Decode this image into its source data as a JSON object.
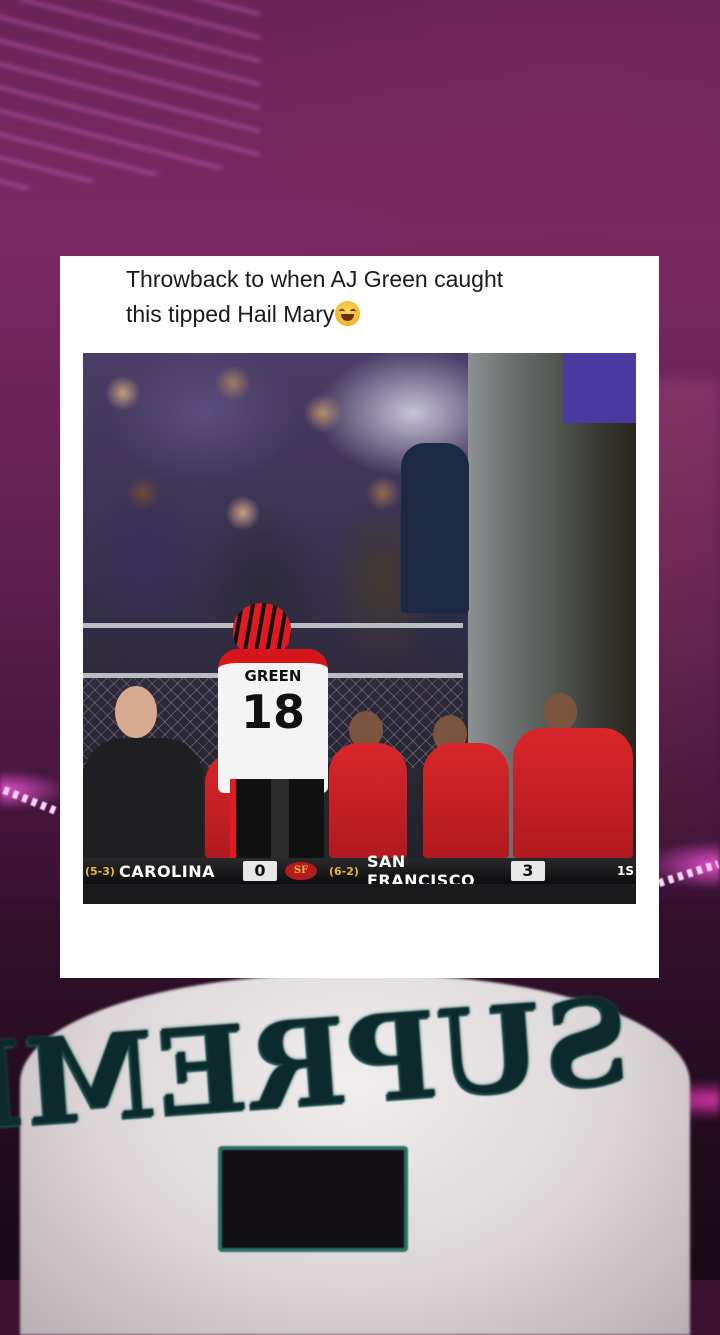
{
  "tweet": {
    "text_line1": "Throwback to when AJ Green caught",
    "text_line2": "this tipped Hail Mary",
    "emoji": "face-with-tears-of-joy-icon"
  },
  "video": {
    "player_name": "GREEN",
    "player_number": "18",
    "scorebug": {
      "away_record": "(5-3)",
      "away_team": "CAROLINA",
      "away_score": "0",
      "network_logo": "SF",
      "home_record": "(6-2)",
      "home_team": "SAN FRANCISCO",
      "home_score": "3",
      "quarter": "1S"
    }
  },
  "background": {
    "hat_text": "SUPREME"
  },
  "colors": {
    "card_bg": "#ffffff",
    "text": "#1a1a1a",
    "neon": "#ff5ae6",
    "staff_red": "#d9262a",
    "bengals_orange_red": "#e01a1f"
  }
}
